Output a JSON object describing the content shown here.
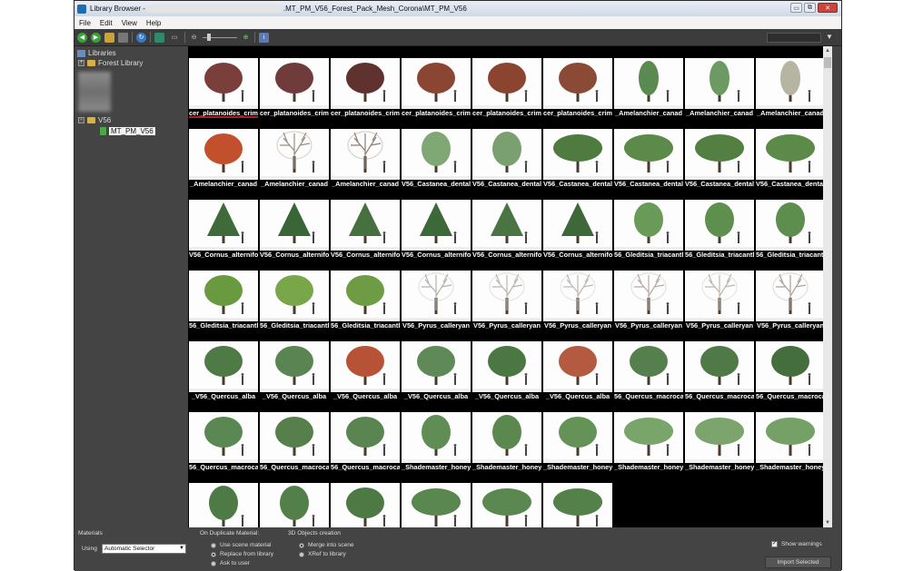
{
  "window": {
    "title_prefix": "Library Browser - ",
    "title_suffix": ".MT_PM_V56_Forest_Pack_Mesh_Corona\\MT_PM_V56",
    "buttons": {
      "minimize": "▭",
      "maximize": "⧉",
      "close": "✕"
    }
  },
  "menu": [
    "File",
    "Edit",
    "View",
    "Help"
  ],
  "toolbar": {
    "icons": [
      "back-icon",
      "forward-icon",
      "open-folder-icon",
      "save-icon",
      "refresh-icon",
      "tree-view-icon",
      "zoom-out-icon",
      "zoom-in-icon",
      "info-icon",
      "filter-icon"
    ],
    "zoom_level": 0.15
  },
  "tree": {
    "root": "Libraries",
    "forest_library": "Forest Library",
    "v56": "V56",
    "selected": "MT_PM_V56"
  },
  "grid": {
    "items": [
      {
        "label": "cer_platanoides_crims",
        "foliage": "#7a3f3a",
        "shape": "round"
      },
      {
        "label": "cer_platanoides_crims",
        "foliage": "#6f3b3b",
        "shape": "round"
      },
      {
        "label": "cer_platanoides_crims",
        "foliage": "#5f3230",
        "shape": "round"
      },
      {
        "label": "cer_platanoides_crims",
        "foliage": "#8a4632",
        "shape": "round"
      },
      {
        "label": "cer_platanoides_crims",
        "foliage": "#8a4430",
        "shape": "round"
      },
      {
        "label": "cer_platanoides_crims",
        "foliage": "#8b4a35",
        "shape": "round"
      },
      {
        "label": "_Amelanchier_canad",
        "foliage": "#5a8a52",
        "shape": "narrow"
      },
      {
        "label": "_Amelanchier_canad",
        "foliage": "#6d9a63",
        "shape": "narrow"
      },
      {
        "label": "_Amelanchier_canad",
        "foliage": "#b6b4a2",
        "shape": "narrow"
      },
      {
        "label": "_Amelanchier_canad",
        "foliage": "#c2502c",
        "shape": "round"
      },
      {
        "label": "_Amelanchier_canad",
        "foliage": "#9c8c82",
        "shape": "bare"
      },
      {
        "label": "_Amelanchier_canad",
        "foliage": "#8d7d74",
        "shape": "bare"
      },
      {
        "label": "V56_Castanea_dental",
        "foliage": "#7fa874",
        "shape": "oval"
      },
      {
        "label": "V56_Castanea_dental",
        "foliage": "#7aa06f",
        "shape": "oval"
      },
      {
        "label": "V56_Castanea_dental",
        "foliage": "#4f7a40",
        "shape": "wide"
      },
      {
        "label": "V56_Castanea_dental",
        "foliage": "#5b8a4a",
        "shape": "wide"
      },
      {
        "label": "V56_Castanea_dental",
        "foliage": "#547f42",
        "shape": "wide"
      },
      {
        "label": "V56_Castanea_dental",
        "foliage": "#5c8a48",
        "shape": "wide"
      },
      {
        "label": "V56_Cornus_alternifol",
        "foliage": "#3f6a3a",
        "shape": "conic"
      },
      {
        "label": "V56_Cornus_alternifol",
        "foliage": "#3a6536",
        "shape": "conic"
      },
      {
        "label": "V56_Cornus_alternifol",
        "foliage": "#46703e",
        "shape": "conic"
      },
      {
        "label": "V56_Cornus_alternifol",
        "foliage": "#3d6838",
        "shape": "conic"
      },
      {
        "label": "V56_Cornus_alternifol",
        "foliage": "#4a7442",
        "shape": "conic"
      },
      {
        "label": "V56_Cornus_alternifol",
        "foliage": "#3e6839",
        "shape": "conic"
      },
      {
        "label": "56_Gleditsia_triacantl",
        "foliage": "#6a9a58",
        "shape": "oval"
      },
      {
        "label": "56_Gleditsia_triacantl",
        "foliage": "#5f8f4f",
        "shape": "oval"
      },
      {
        "label": "56_Gleditsia_triacantl",
        "foliage": "#5d8e4d",
        "shape": "oval"
      },
      {
        "label": "56_Gleditsia_triacantl",
        "foliage": "#6a9a40",
        "shape": "round"
      },
      {
        "label": "56_Gleditsia_triacantl",
        "foliage": "#7aa64a",
        "shape": "round"
      },
      {
        "label": "56_Gleditsia_triacantl",
        "foliage": "#6e9c44",
        "shape": "round"
      },
      {
        "label": "V56_Pyrus_calleryan",
        "foliage": "#b4b2ae",
        "shape": "bare"
      },
      {
        "label": "V56_Pyrus_calleryan",
        "foliage": "#b8b5b0",
        "shape": "bare"
      },
      {
        "label": "V56_Pyrus_calleryan",
        "foliage": "#bcb9b4",
        "shape": "bare"
      },
      {
        "label": "V56_Pyrus_calleryan",
        "foliage": "#b7aaa4",
        "shape": "bare"
      },
      {
        "label": "V56_Pyrus_calleryan",
        "foliage": "#bab6b2",
        "shape": "bare"
      },
      {
        "label": "V56_Pyrus_calleryan",
        "foliage": "#a9a29c",
        "shape": "bare"
      },
      {
        "label": "_V56_Quercus_alba",
        "foliage": "#4e7a46",
        "shape": "round"
      },
      {
        "label": "_V56_Quercus_alba",
        "foliage": "#5a8552",
        "shape": "round"
      },
      {
        "label": "_V56_Quercus_alba",
        "foliage": "#b85236",
        "shape": "round"
      },
      {
        "label": "_V56_Quercus_alba",
        "foliage": "#5f8a57",
        "shape": "round"
      },
      {
        "label": "_V56_Quercus_alba",
        "foliage": "#4b7743",
        "shape": "round"
      },
      {
        "label": "_V56_Quercus_alba",
        "foliage": "#b45a40",
        "shape": "round"
      },
      {
        "label": "56_Quercus_macroca",
        "foliage": "#55804d",
        "shape": "round"
      },
      {
        "label": "56_Quercus_macroca",
        "foliage": "#4f7a47",
        "shape": "round"
      },
      {
        "label": "56_Quercus_macroca",
        "foliage": "#446f3d",
        "shape": "round"
      },
      {
        "label": "56_Quercus_macroca",
        "foliage": "#5b8752",
        "shape": "round"
      },
      {
        "label": "56_Quercus_macroca",
        "foliage": "#567f4c",
        "shape": "round"
      },
      {
        "label": "56_Quercus_macroca",
        "foliage": "#5a8450",
        "shape": "round"
      },
      {
        "label": "_Shademaster_honeyl",
        "foliage": "#5f8d54",
        "shape": "oval"
      },
      {
        "label": "_Shademaster_honeyl",
        "foliage": "#5a884f",
        "shape": "oval"
      },
      {
        "label": "_Shademaster_honeyl",
        "foliage": "#649257",
        "shape": "round"
      },
      {
        "label": "_Shademaster_honeyl",
        "foliage": "#79a46a",
        "shape": "wide"
      },
      {
        "label": "_Shademaster_honeyl",
        "foliage": "#7ba56c",
        "shape": "wide"
      },
      {
        "label": "_Shademaster_honeyl",
        "foliage": "#75a066",
        "shape": "wide"
      },
      {
        "label": "",
        "foliage": "#4e7a45",
        "shape": "oval"
      },
      {
        "label": "",
        "foliage": "#53804a",
        "shape": "oval"
      },
      {
        "label": "",
        "foliage": "#4d7944",
        "shape": "round"
      },
      {
        "label": "",
        "foliage": "#5a874f",
        "shape": "wide"
      },
      {
        "label": "",
        "foliage": "#5b8850",
        "shape": "wide"
      },
      {
        "label": "",
        "foliage": "#548149",
        "shape": "wide"
      }
    ]
  },
  "bottom": {
    "materials_label": "Materials",
    "using_label": "Using",
    "using_value": "Automatic Selector",
    "dup_label": "On Duplicate Material:",
    "dup_options": [
      "Use scene material",
      "Replace from library",
      "Ask to user"
    ],
    "dup_selected": 1,
    "objects_label": "3D Objects creation",
    "obj_options": [
      "Merge into scene",
      "XRef to library"
    ],
    "obj_selected": 0,
    "show_warnings": "Show warnings",
    "show_warnings_checked": true,
    "import_button": "Import Selected"
  }
}
